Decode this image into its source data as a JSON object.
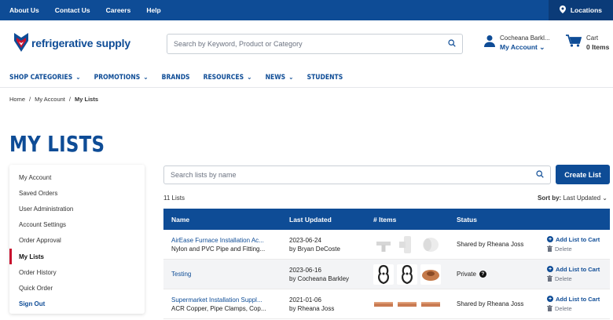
{
  "topbar": {
    "links": [
      "About Us",
      "Contact Us",
      "Careers",
      "Help"
    ],
    "locations": "Locations"
  },
  "header": {
    "brand": "refrigerative supply",
    "search_placeholder": "Search by Keyword, Product or Category",
    "account_name": "Cocheana Barkl...",
    "account_label": "My Account",
    "cart_label": "Cart",
    "cart_items": "0 Items"
  },
  "nav": {
    "items": [
      "SHOP CATEGORIES",
      "PROMOTIONS",
      "BRANDS",
      "RESOURCES",
      "NEWS",
      "STUDENTS"
    ]
  },
  "breadcrumb": [
    "Home",
    "My Account",
    "My Lists"
  ],
  "page_title": "MY LISTS",
  "sidebar": {
    "items": [
      "My Account",
      "Saved Orders",
      "User Administration",
      "Account Settings",
      "Order Approval",
      "My Lists",
      "Order History",
      "Quick Order",
      "Sign Out"
    ]
  },
  "lists": {
    "search_placeholder": "Search lists by name",
    "create_label": "Create List",
    "count": "11 Lists",
    "sort_label": "Sort by:",
    "sort_value": "Last Updated",
    "columns": [
      "Name",
      "Last Updated",
      "# Items",
      "Status"
    ],
    "add_label": "Add List to Cart",
    "delete_label": "Delete",
    "rows": [
      {
        "name": "AirEase Furnace Installation Ac...",
        "desc": "Nylon and PVC Pipe and Fitting...",
        "date": "2023-06-24",
        "by": "by Bryan DeCoste",
        "status": "Shared by Rheana Joss"
      },
      {
        "name": "Testing",
        "desc": "",
        "date": "2023-06-16",
        "by": "by Cocheana Barkley",
        "status": "Private"
      },
      {
        "name": "Supermarket Installation Suppl...",
        "desc": "ACR Copper, Pipe Clamps, Cop...",
        "date": "2021-01-06",
        "by": "by Rheana Joss",
        "status": "Shared by Rheana Joss"
      }
    ]
  }
}
